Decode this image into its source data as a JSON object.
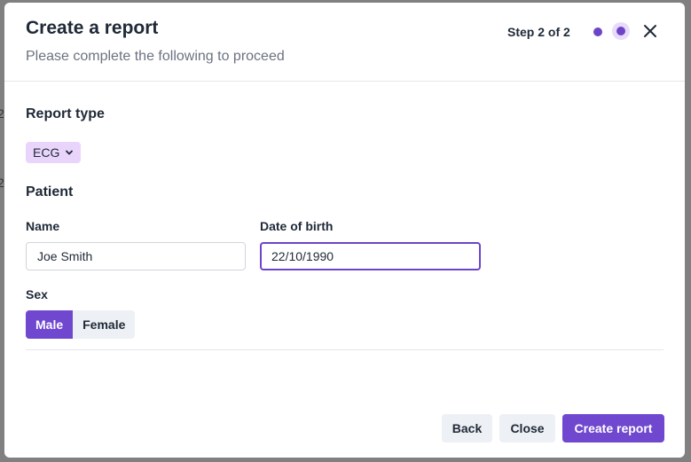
{
  "dialog": {
    "title": "Create a report",
    "subtitle": "Please complete the following to proceed",
    "step_text": "Step 2 of 2",
    "close_icon": "close-icon"
  },
  "report_type": {
    "heading": "Report type",
    "selected": "ECG"
  },
  "patient": {
    "heading": "Patient",
    "name_label": "Name",
    "name_value": "Joe Smith",
    "dob_label": "Date of birth",
    "dob_value": "22/10/1990",
    "sex_label": "Sex",
    "sex_options": [
      "Male",
      "Female"
    ],
    "sex_selected": "Male"
  },
  "footer": {
    "back_label": "Back",
    "close_label": "Close",
    "create_label": "Create report"
  },
  "colors": {
    "accent": "#7047cf",
    "tag_bg": "#e9d5fb",
    "secondary_bg": "#edf0f4"
  }
}
